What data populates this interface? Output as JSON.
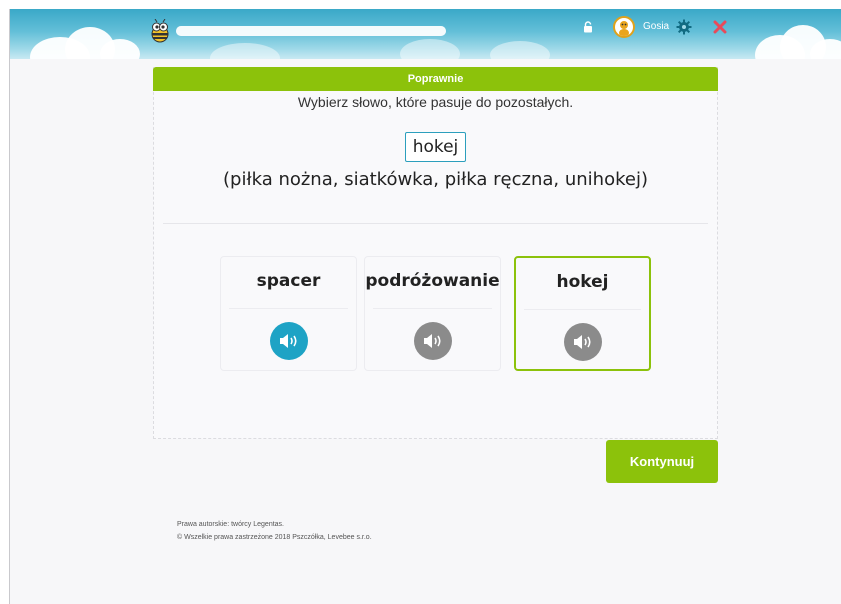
{
  "header": {
    "username": "Gosia",
    "progress": 1.0,
    "icons": [
      "bee-logo-icon",
      "lock-icon",
      "avatar",
      "gear-icon",
      "close-icon"
    ]
  },
  "status": {
    "label": "Poprawnie",
    "color": "#8cc20b"
  },
  "task": {
    "instruction": "Wybierz słowo, które pasuje do pozostałych.",
    "answer": "hokej",
    "hint": "(piłka nożna, siatkówka, piłka ręczna, unihokej)"
  },
  "options": [
    {
      "word": "spacer",
      "audio_icon": "speaker-icon",
      "audio_active": true,
      "selected": false
    },
    {
      "word": "podróżowanie",
      "audio_icon": "speaker-icon",
      "audio_active": false,
      "selected": false
    },
    {
      "word": "hokej",
      "audio_icon": "speaker-icon",
      "audio_active": false,
      "selected": true
    }
  ],
  "continue_label": "Kontynuuj",
  "footer": {
    "line1": "Prawa autorskie: twórcy Legentas.",
    "line2": "© Wszelkie prawa zastrzeżone 2018 Pszczółka, Levebee s.r.o."
  },
  "colors": {
    "accent_green": "#8cc20b",
    "accent_blue": "#1ea3c5",
    "header_blue": "#3aa8c8"
  }
}
